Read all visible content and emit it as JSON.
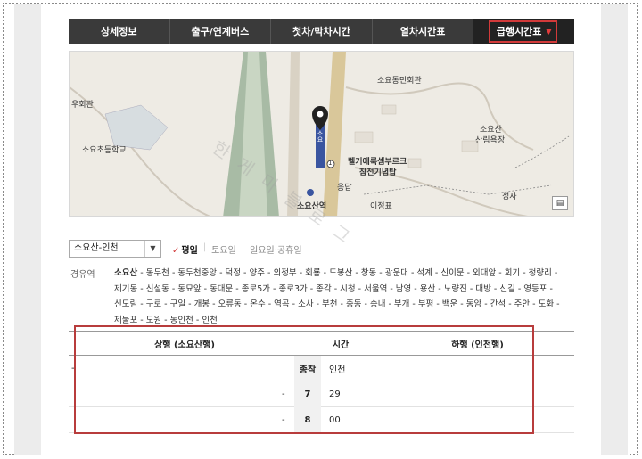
{
  "tabs": [
    {
      "label": "상세정보"
    },
    {
      "label": "출구/연계버스"
    },
    {
      "label": "첫차/막차시간"
    },
    {
      "label": "열차시간표"
    },
    {
      "label": "급행시간표",
      "caret": "▼"
    }
  ],
  "map": {
    "labels": {
      "hall_left": "우회관",
      "school": "소요초등학교",
      "soyo_hall": "소요동민회관",
      "memorial_1": "벨기에룩셈부르크",
      "memorial_2": "참전기념탑",
      "station": "소요산역",
      "mountain_1": "소요산",
      "mountain_2": "산림욕장",
      "pavilion": "정자",
      "ijeong": "이정표",
      "station_vertical": "소요",
      "circle_num": "1",
      "map_marker": "응답"
    },
    "watermark": "한 게 마 블 로 그"
  },
  "route_select": {
    "value": "소요산-인천",
    "arrow": "▼"
  },
  "day_types": {
    "weekday": "평일",
    "check": "✓",
    "saturday": "토요일",
    "holiday": "일요일·공휴일",
    "sep": "|"
  },
  "via": {
    "label": "경유역",
    "first": "소요산",
    "rest": " - 동두천 - 동두천중앙 - 덕정 - 양주 - 의정부 - 회룡 - 도봉산 - 창동 - 광운대 - 석계 - 신이문 - 외대앞 - 회기 - 청량리 - 제기동 - 신설동 - 동묘앞 - 동대문 - 종로5가 - 종로3가 - 종각 - 시청 - 서울역 - 남영 - 용산 - 노량진 - 대방 - 신길 - 영등포 - 신도림 - 구로 - 구일 - 개봉 - 오류동 - 온수 - 역곡 - 소사 - 부천 - 중동 - 송내 - 부개 - 부평 - 백운 - 동암 - 간석 - 주안 - 도화 - 제물포 - 도원 - 동인천 - 인천"
  },
  "timetable": {
    "headers": {
      "up": "상행 (소요산행)",
      "time": "시간",
      "down": "하행 (인천행)"
    },
    "rows": [
      {
        "left": "-",
        "up": "",
        "hour": "종착",
        "down": "인천"
      },
      {
        "left": "",
        "up": "-",
        "hour": "7",
        "down": "29"
      },
      {
        "left": "",
        "up": "-",
        "hour": "8",
        "down": "00"
      }
    ]
  }
}
